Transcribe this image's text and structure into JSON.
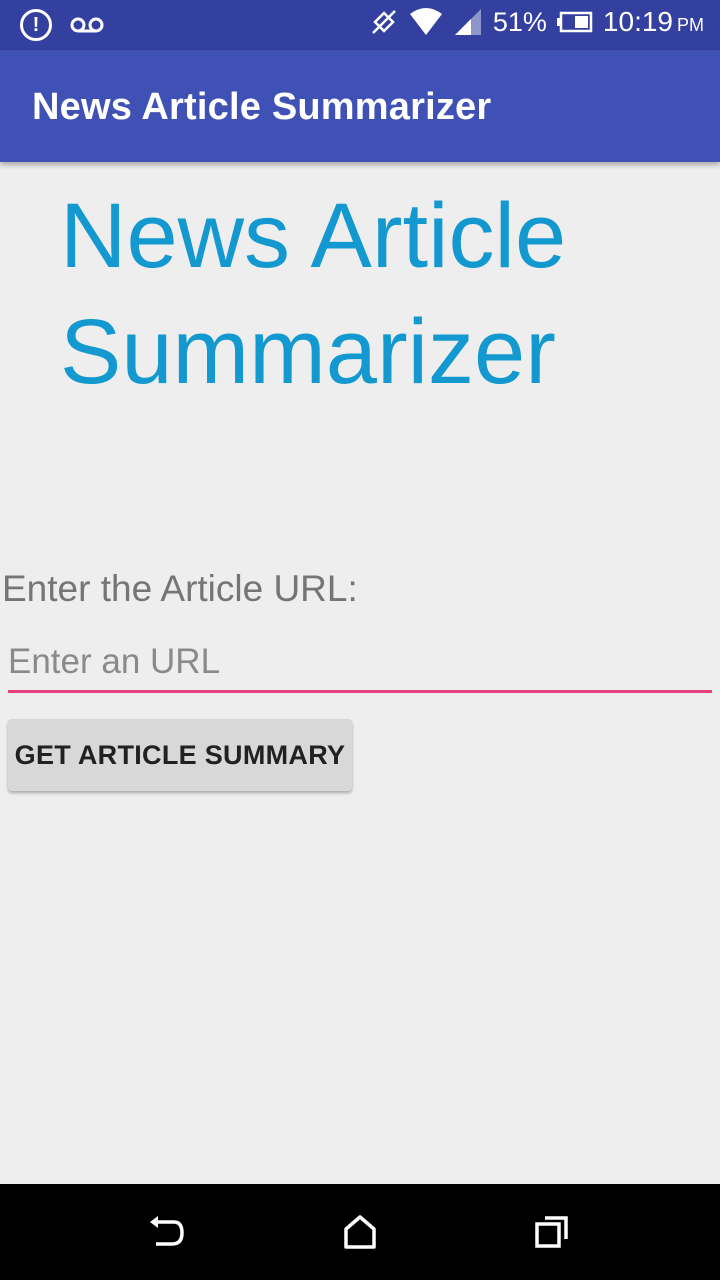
{
  "status_bar": {
    "battery_percent": "51%",
    "time": "10:19",
    "ampm": "PM",
    "icons": [
      "alert-icon",
      "voicemail-icon",
      "data-off-icon",
      "wifi-icon",
      "signal-icon",
      "battery-icon"
    ]
  },
  "app_bar": {
    "title": "News Article Summarizer"
  },
  "main": {
    "headline_line1": "News Article",
    "headline_line2": "Summarizer",
    "url_label": "Enter the Article URL:",
    "url_input": {
      "value": "",
      "placeholder": "Enter an URL"
    },
    "button_label": "GET ARTICLE SUMMARY"
  },
  "nav_bar": {
    "icons": [
      "back-icon",
      "home-icon",
      "recents-icon"
    ]
  },
  "colors": {
    "status_bar": "#3340a0",
    "app_bar": "#3f51b5",
    "headline": "#1399cf",
    "accent_underline": "#e84080",
    "background": "#eeeeee",
    "button": "#d8d8d8"
  }
}
